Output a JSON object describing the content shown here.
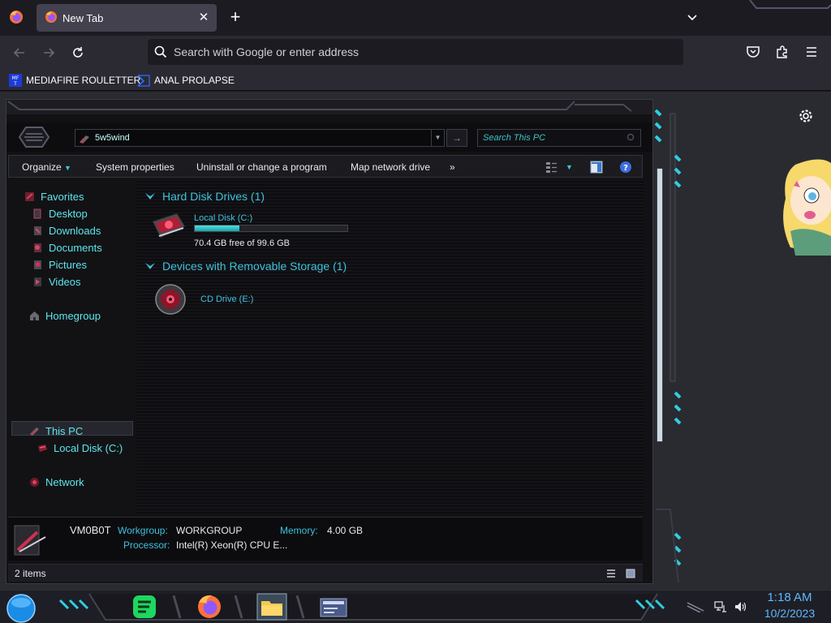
{
  "browser": {
    "tab": {
      "title": "New Tab"
    },
    "urlbar": {
      "placeholder": "Search with Google or enter address"
    },
    "bookmarks": [
      {
        "label": "MEDIAFIRE ROULETTER",
        "icon": "mediafire-icon"
      },
      {
        "label": "ANAL PROLAPSE",
        "icon": "prolapse-icon"
      }
    ]
  },
  "explorer": {
    "address": {
      "value": "5w5wind"
    },
    "search": {
      "placeholder": "Search This PC"
    },
    "commands": {
      "organize": "Organize",
      "system_properties": "System properties",
      "uninstall": "Uninstall or change a program",
      "map_drive": "Map network drive",
      "more": "»"
    },
    "nav": {
      "favorites": "Favorites",
      "desktop": "Desktop",
      "downloads": "Downloads",
      "documents": "Documents",
      "pictures": "Pictures",
      "videos": "Videos",
      "homegroup": "Homegroup",
      "this_pc": "This PC",
      "local_disk": "Local Disk (C:)",
      "network": "Network"
    },
    "groups": {
      "hdd": "Hard Disk Drives (1)",
      "removable": "Devices with Removable Storage (1)"
    },
    "drives": {
      "c_name": "Local Disk (C:)",
      "c_free": "70.4 GB free of 99.6 GB",
      "c_used_fraction": 0.29,
      "e_name": "CD Drive (E:)"
    },
    "details": {
      "computer": "VM0B0T",
      "workgroup_label": "Workgroup:",
      "workgroup": "WORKGROUP",
      "memory_label": "Memory:",
      "memory": "4.00 GB",
      "processor_label": "Processor:",
      "processor": "Intel(R) Xeon(R) CPU E..."
    },
    "status": {
      "items": "2 items"
    }
  },
  "taskbar": {
    "time": "1:18 AM",
    "date": "10/2/2023"
  },
  "colors": {
    "accent_cyan": "#3ec2dc",
    "clock_blue": "#5eb8ff",
    "firefox_orange": "#ff7139"
  }
}
